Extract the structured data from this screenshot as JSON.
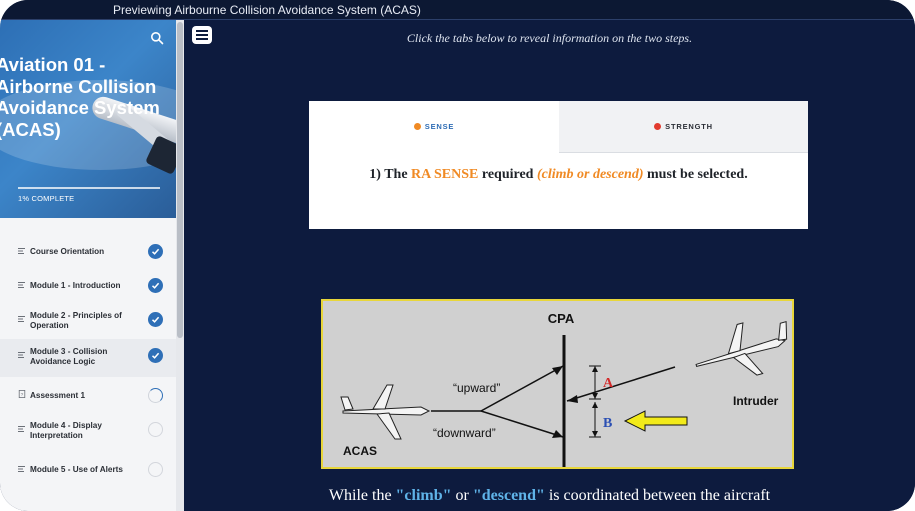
{
  "window": {
    "title": "Previewing Airbourne Collision Avoidance System (ACAS)"
  },
  "sidebar": {
    "course_title": "Aviation 01 - Airborne Collision Avoidance System (ACAS)",
    "progress_text": "1% COMPLETE",
    "search_icon": "search-icon",
    "items": [
      {
        "label": "Course Orientation",
        "status": "complete",
        "icon": "lesson-lines-icon"
      },
      {
        "label": "Module 1 - Introduction",
        "status": "complete",
        "icon": "lesson-lines-icon"
      },
      {
        "label": "Module 2 - Principles of Operation",
        "status": "complete",
        "icon": "lesson-lines-icon"
      },
      {
        "label": "Module 3 - Collision Avoidance Logic",
        "status": "complete",
        "icon": "lesson-lines-icon"
      },
      {
        "label": "Assessment 1",
        "status": "in-progress",
        "icon": "quiz-icon"
      },
      {
        "label": "Module 4 - Display Interpretation",
        "status": "not-started",
        "icon": "lesson-lines-icon"
      },
      {
        "label": "Module 5 - Use of Alerts",
        "status": "not-started",
        "icon": "lesson-lines-icon"
      }
    ]
  },
  "main": {
    "menu_icon": "hamburger-menu-icon",
    "instruction": "Click the tabs below to reveal information on the two steps.",
    "tabs": [
      {
        "label": "SENSE",
        "dot_color": "#f08a24",
        "selected": true
      },
      {
        "label": "STRENGTH",
        "dot_color": "#e23b2e",
        "selected": false
      }
    ],
    "tab_content": {
      "prefix": "1) The ",
      "highlight": "RA SENSE",
      "middle": " required ",
      "italic": "(climb or descend)",
      "suffix": " must be selected."
    },
    "diagram": {
      "cpa": "CPA",
      "upward": "“upward”",
      "downward": "“downward”",
      "acas": "ACAS",
      "intruder": "Intruder",
      "a": "A",
      "b": "B"
    },
    "caption": {
      "prefix": "While the ",
      "climb": "\"climb\"",
      "or": " or ",
      "descend": "\"descend\"",
      "suffix": " is coordinated between the aircraft"
    }
  },
  "colors": {
    "background": "#0d1b3e",
    "accent_blue": "#2e6fb7",
    "highlight_orange": "#f08a24",
    "highlight_cyan": "#5fb3e8"
  }
}
